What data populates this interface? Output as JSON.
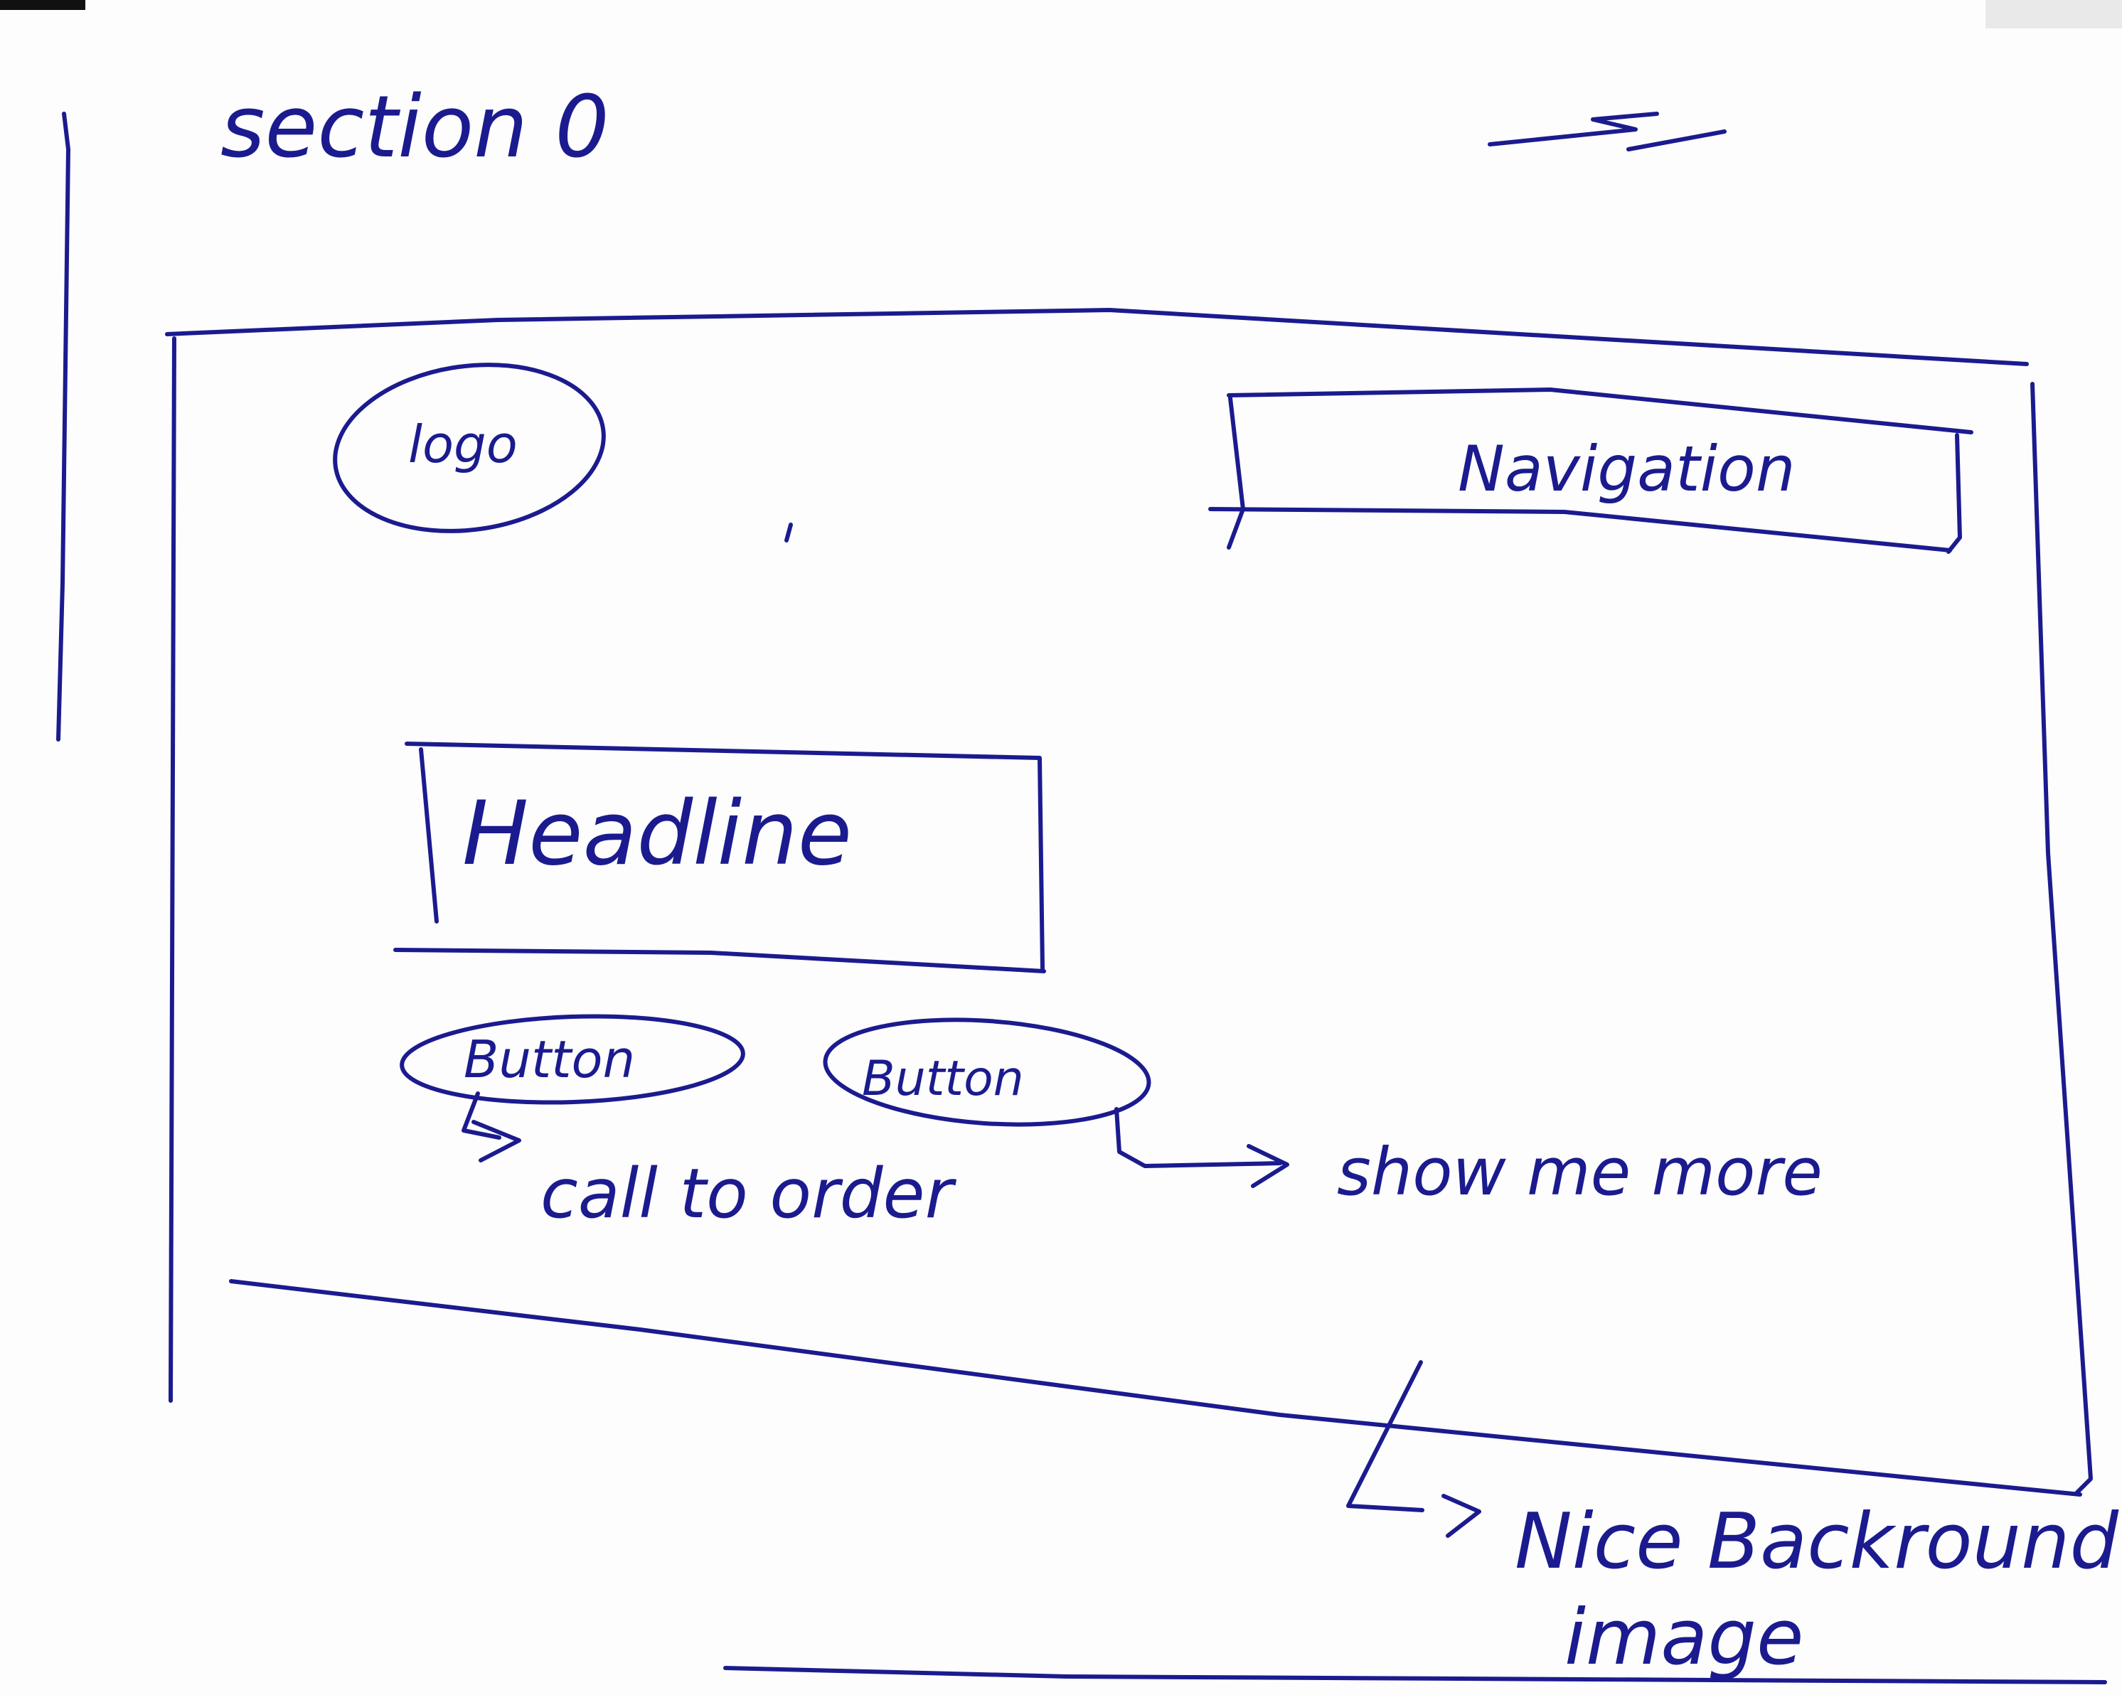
{
  "page": {
    "title": "section 0"
  },
  "header": {
    "logo_label": "logo",
    "navigation_label": "Navigation"
  },
  "hero": {
    "headline_label": "Headline",
    "primary_button_label": "Button",
    "secondary_button_label": "Button"
  },
  "annotations": {
    "primary_button_note": "call to order",
    "secondary_button_note": "show me more",
    "background_note_line1": "Nice Backround",
    "background_note_line2": "image"
  },
  "colors": {
    "ink": "#1b1b8f",
    "paper": "#fdfdfd"
  }
}
